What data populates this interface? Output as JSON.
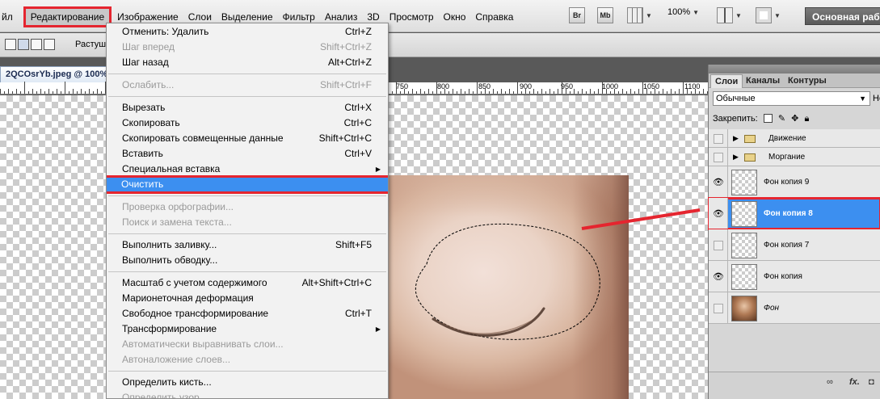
{
  "menubar": {
    "items": [
      {
        "id": "file",
        "label": "йл",
        "cut": true
      },
      {
        "id": "edit",
        "label": "Редактирование",
        "active": true
      },
      {
        "id": "image",
        "label": "Изображение"
      },
      {
        "id": "layers",
        "label": "Слои"
      },
      {
        "id": "select",
        "label": "Выделение"
      },
      {
        "id": "filter",
        "label": "Фильтр"
      },
      {
        "id": "analysis",
        "label": "Анализ"
      },
      {
        "id": "3d",
        "label": "3D"
      },
      {
        "id": "view",
        "label": "Просмотр"
      },
      {
        "id": "window",
        "label": "Окно"
      },
      {
        "id": "help",
        "label": "Справка"
      }
    ],
    "br_label": "Br",
    "mb_label": "Mb",
    "zoom": "100%",
    "workspace": "Основная работа"
  },
  "options_bar": {
    "label": "Растушевка"
  },
  "document": {
    "tab_title": "2QCOsrYb.jpeg @ 100%",
    "ruler_labels": [
      "750",
      "800",
      "850",
      "900",
      "950",
      "1000",
      "1050",
      "1100"
    ]
  },
  "edit_menu": {
    "items": [
      {
        "label": "Отменить: Удалить",
        "shortcut": "Ctrl+Z",
        "disabled": false
      },
      {
        "label": "Шаг вперед",
        "shortcut": "Shift+Ctrl+Z",
        "disabled": true
      },
      {
        "label": "Шаг назад",
        "shortcut": "Alt+Ctrl+Z",
        "disabled": false
      },
      {
        "sep": true
      },
      {
        "label": "Ослабить...",
        "shortcut": "Shift+Ctrl+F",
        "disabled": true
      },
      {
        "sep": true
      },
      {
        "label": "Вырезать",
        "shortcut": "Ctrl+X",
        "disabled": false
      },
      {
        "label": "Скопировать",
        "shortcut": "Ctrl+C",
        "disabled": false
      },
      {
        "label": "Скопировать совмещенные данные",
        "shortcut": "Shift+Ctrl+C",
        "disabled": false
      },
      {
        "label": "Вставить",
        "shortcut": "Ctrl+V",
        "disabled": false
      },
      {
        "label": "Специальная вставка",
        "shortcut": "",
        "submenu": true,
        "disabled": false
      },
      {
        "label": "Очистить",
        "shortcut": "",
        "disabled": false,
        "highlighted": true
      },
      {
        "sep": true
      },
      {
        "label": "Проверка орфографии...",
        "shortcut": "",
        "disabled": true
      },
      {
        "label": "Поиск и замена текста...",
        "shortcut": "",
        "disabled": true
      },
      {
        "sep": true
      },
      {
        "label": "Выполнить заливку...",
        "shortcut": "Shift+F5",
        "disabled": false
      },
      {
        "label": "Выполнить обводку...",
        "shortcut": "",
        "disabled": false
      },
      {
        "sep": true
      },
      {
        "label": "Масштаб с учетом содержимого",
        "shortcut": "Alt+Shift+Ctrl+C",
        "disabled": false
      },
      {
        "label": "Марионеточная деформация",
        "shortcut": "",
        "disabled": false
      },
      {
        "label": "Свободное трансформирование",
        "shortcut": "Ctrl+T",
        "disabled": false
      },
      {
        "label": "Трансформирование",
        "shortcut": "",
        "submenu": true,
        "disabled": false
      },
      {
        "label": "Автоматически выравнивать слои...",
        "shortcut": "",
        "disabled": true
      },
      {
        "label": "Автоналожение слоев...",
        "shortcut": "",
        "disabled": true
      },
      {
        "sep": true
      },
      {
        "label": "Определить кисть...",
        "shortcut": "",
        "disabled": false
      },
      {
        "label": "Определить узор...",
        "shortcut": "",
        "disabled": true
      }
    ]
  },
  "layers_panel": {
    "tabs": [
      "Слои",
      "Каналы",
      "Контуры"
    ],
    "active_tab": 0,
    "blend_mode": "Обычные",
    "opacity_cut": "Не",
    "lock_label": "Закрепить:",
    "layers": [
      {
        "name": "Движение",
        "type": "group",
        "visible": false
      },
      {
        "name": "Моргание",
        "type": "group",
        "visible": false
      },
      {
        "name": "Фон копия 9",
        "type": "layer",
        "visible": true
      },
      {
        "name": "Фон копия 8",
        "type": "layer",
        "visible": true,
        "selected": true
      },
      {
        "name": "Фон копия 7",
        "type": "layer",
        "visible": false
      },
      {
        "name": "Фон копия",
        "type": "layer",
        "visible": true
      },
      {
        "name": "Фон",
        "type": "photo",
        "visible": false,
        "italic": true
      }
    ]
  },
  "colors": {
    "highlight": "#3c8ff0",
    "annotation_red": "#e5252f"
  }
}
